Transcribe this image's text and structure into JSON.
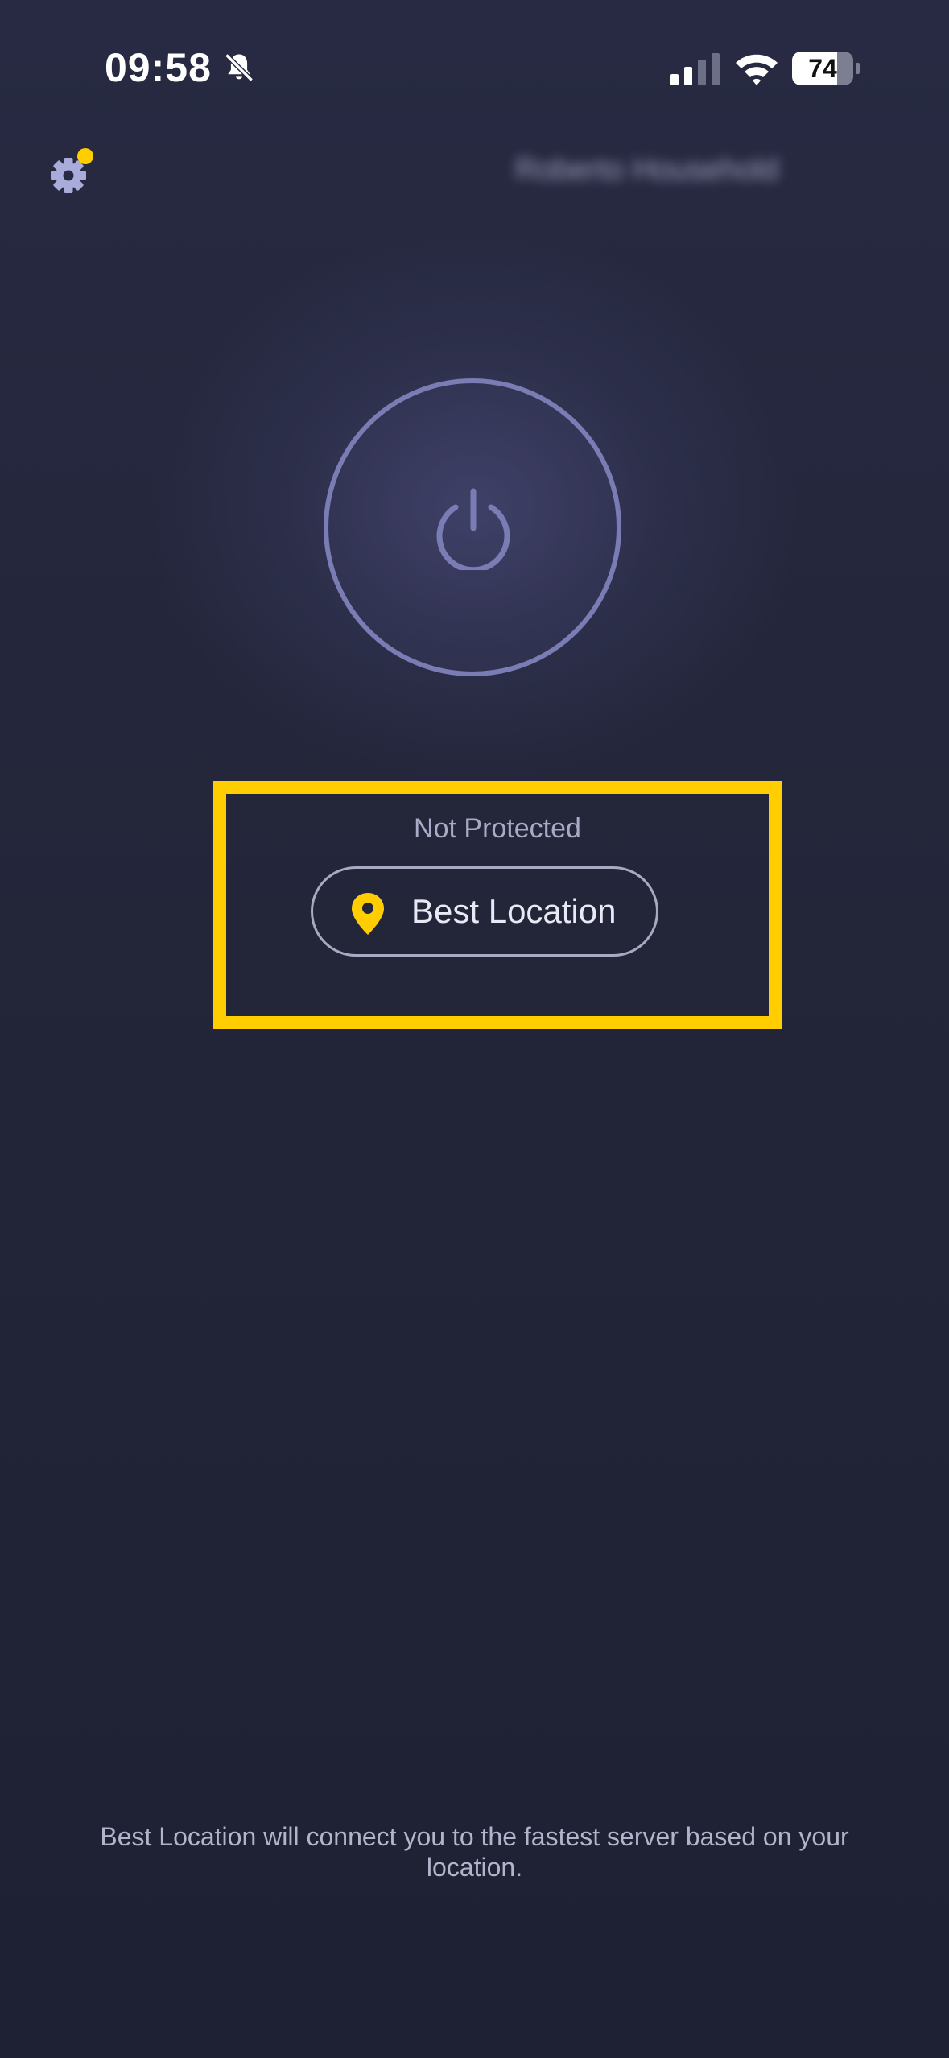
{
  "status_bar": {
    "time": "09:58",
    "battery_level": "74",
    "icons": [
      "bell-slash-icon",
      "cellular-signal-icon",
      "wifi-icon",
      "battery-icon"
    ]
  },
  "header": {
    "settings_icon": "gear-icon",
    "notification_dot_color": "#ffcd00",
    "household_label": "Roberto Household"
  },
  "power": {
    "icon": "power-icon",
    "ring_color": "#7a7cb4"
  },
  "connection": {
    "status": "Not Protected",
    "location_icon": "map-pin-icon",
    "location_label": "Best Location",
    "pin_color": "#ffcd00"
  },
  "highlight_color": "#ffcd00",
  "footer": {
    "note": "Best Location will connect you to the fastest server based on your location."
  }
}
